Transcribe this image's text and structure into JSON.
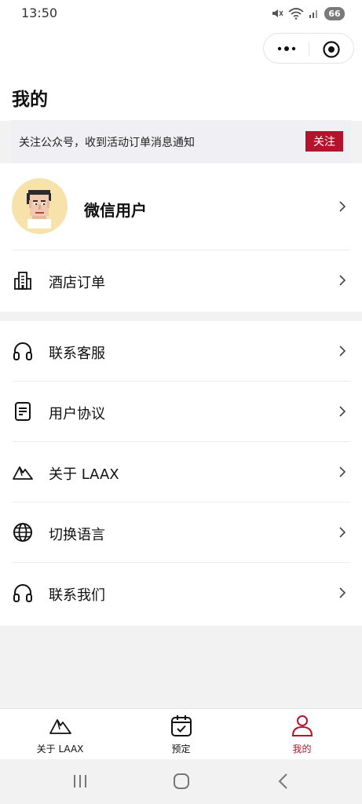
{
  "status_bar": {
    "time": "13:50",
    "battery": "66",
    "icons": [
      "mute-icon",
      "wifi-icon",
      "signal-icon"
    ]
  },
  "header": {
    "title": "我的",
    "capsule_icons": [
      "more-dots-icon",
      "close-target-icon"
    ]
  },
  "follow_banner": {
    "text": "关注公众号，收到活动订单消息通知",
    "button": "关注"
  },
  "profile": {
    "name": "微信用户"
  },
  "menu_primary": [
    {
      "label": "酒店订单",
      "icon": "building-icon"
    }
  ],
  "menu_secondary": [
    {
      "label": "联系客服",
      "icon": "headphones-icon"
    },
    {
      "label": "用户协议",
      "icon": "document-icon"
    },
    {
      "label": "关于 LAAX",
      "icon": "mountain-icon"
    },
    {
      "label": "切换语言",
      "icon": "globe-icon"
    },
    {
      "label": "联系我们",
      "icon": "headphones-icon"
    }
  ],
  "tabbar": {
    "items": [
      {
        "label": "关于 LAAX",
        "icon": "mountain-icon"
      },
      {
        "label": "预定",
        "icon": "calendar-check-icon"
      },
      {
        "label": "我的",
        "icon": "user-icon",
        "active": true
      }
    ]
  },
  "colors": {
    "accent": "#b4132b",
    "banner_bg": "#efeff4",
    "avatar_bg": "#f6e2aa",
    "page_bg": "#f2f2f2"
  }
}
